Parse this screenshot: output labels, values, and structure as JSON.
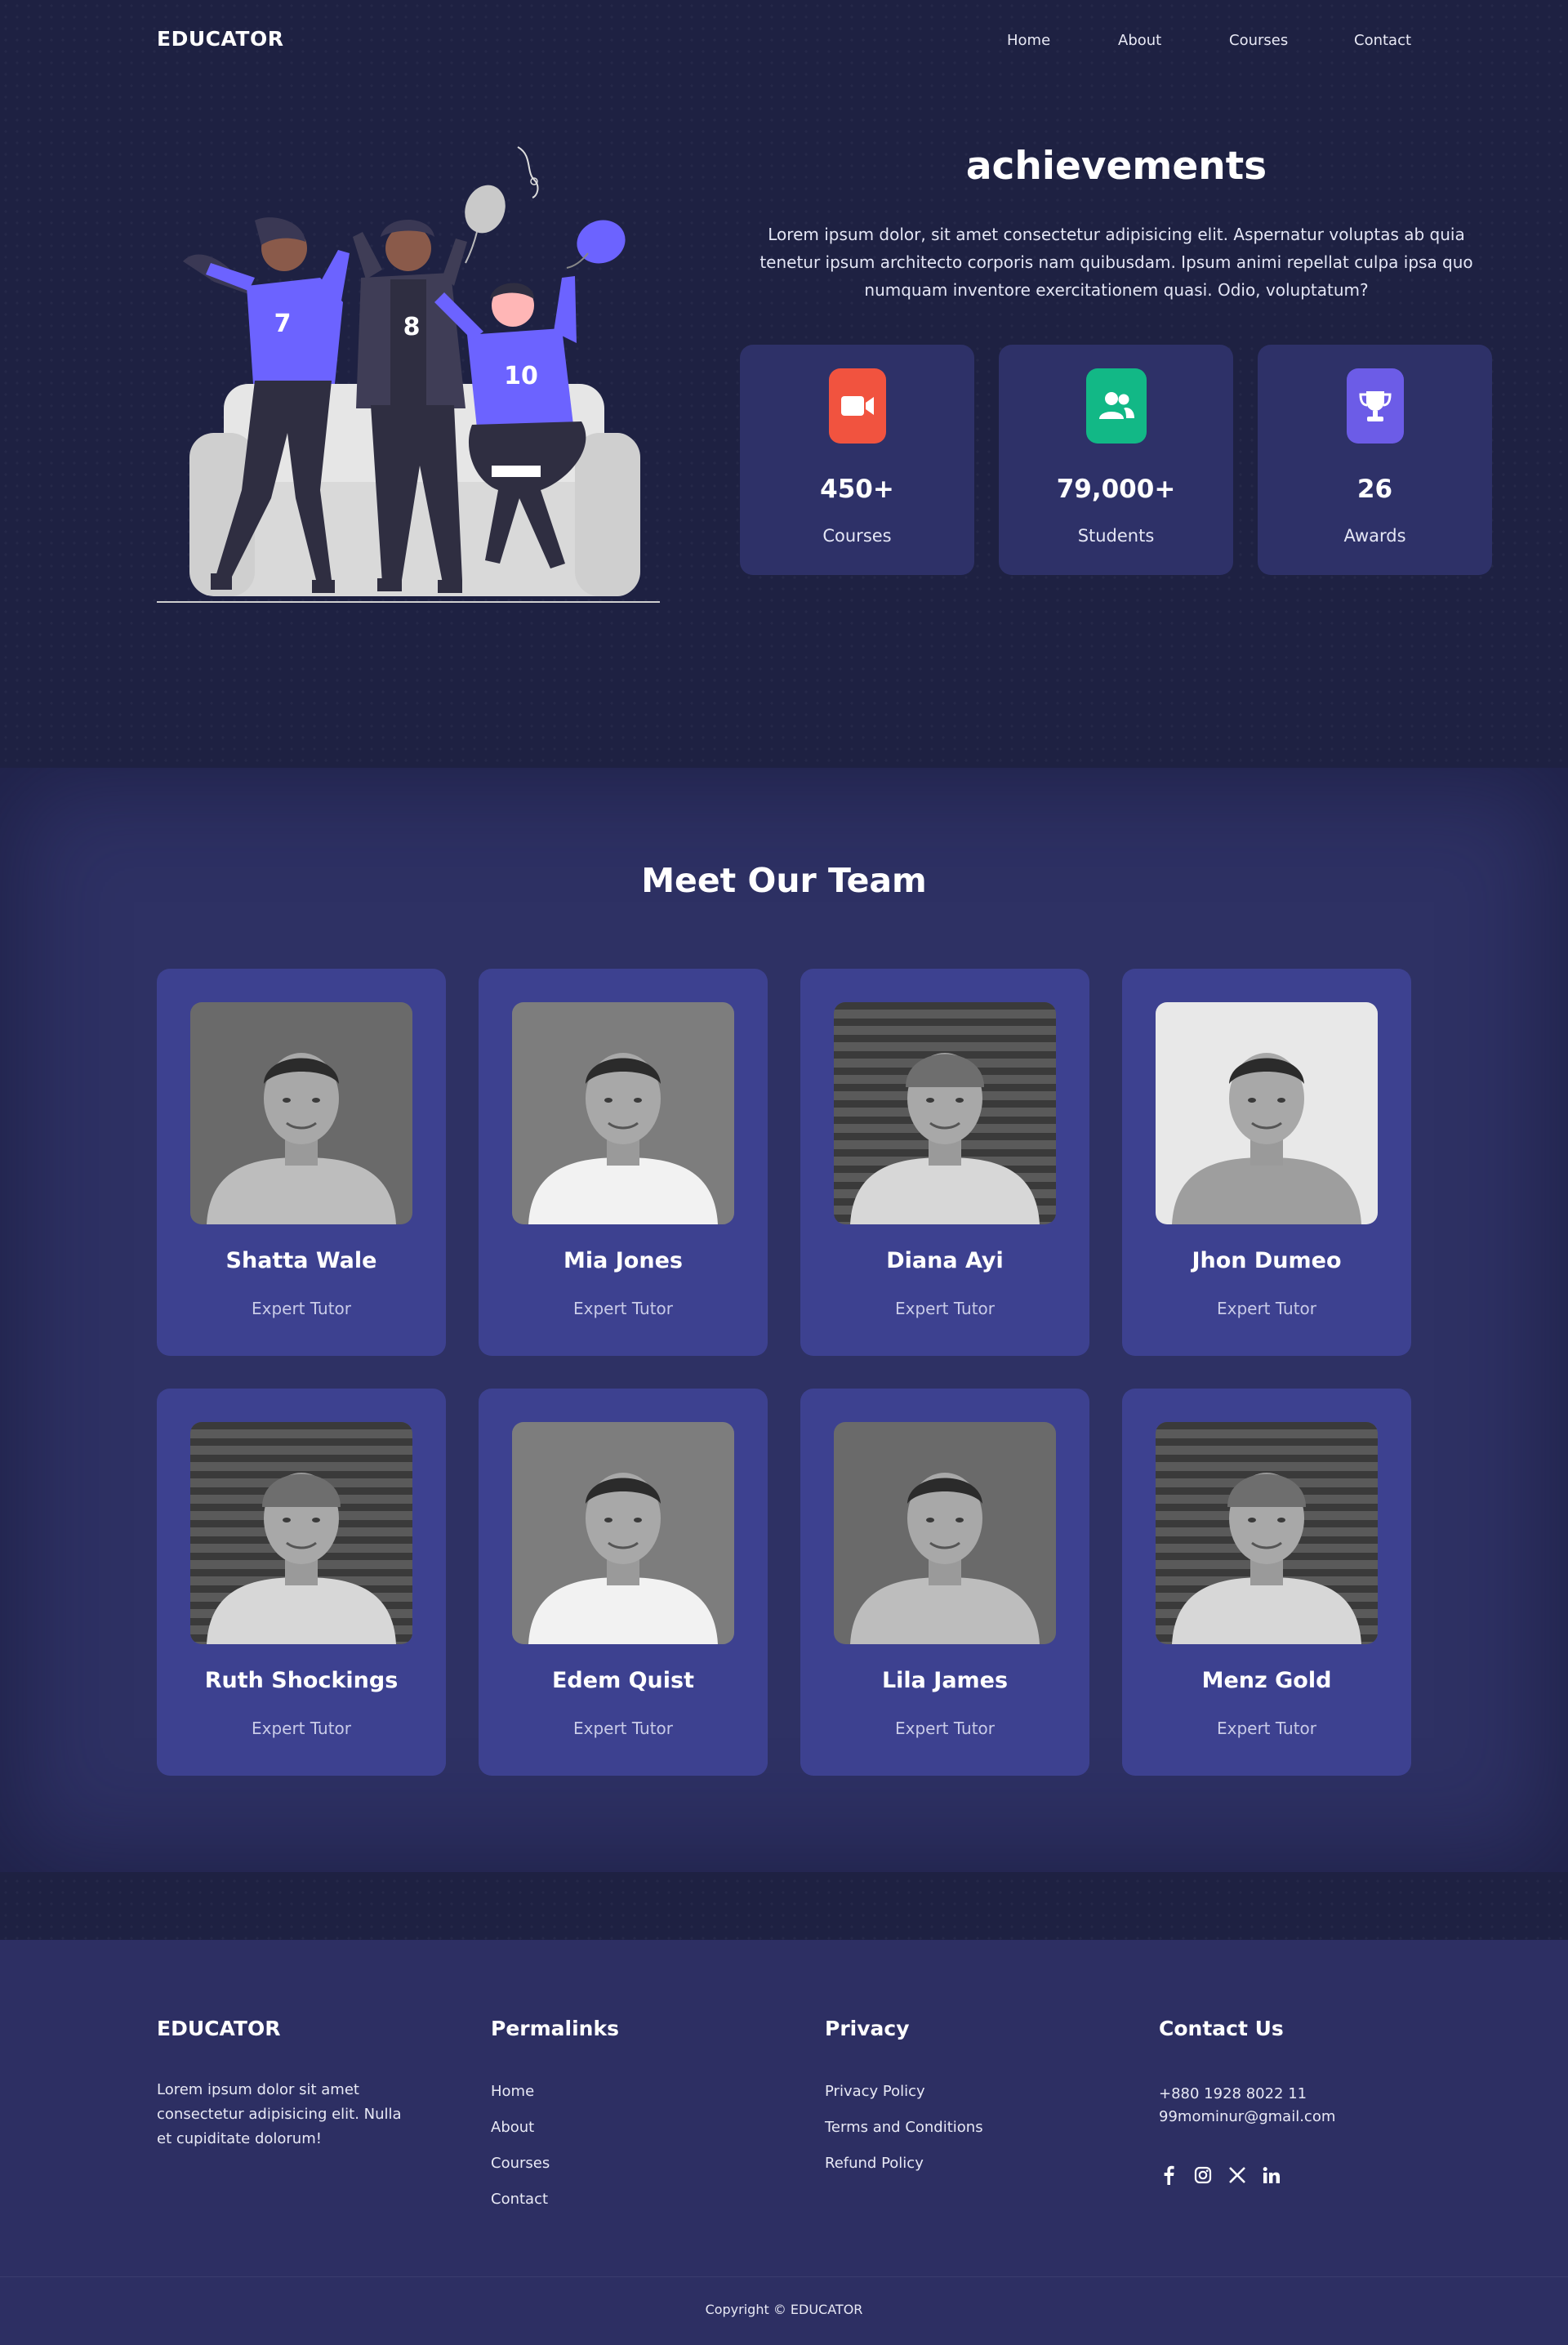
{
  "header": {
    "logo": "EDUCATOR",
    "nav": [
      "Home",
      "About",
      "Courses",
      "Contact"
    ]
  },
  "achievements": {
    "title": "achievements",
    "description": "Lorem ipsum dolor, sit amet consectetur adipisicing elit. Aspernatur voluptas ab quia tenetur ipsum architecto corporis nam quibusdam. Ipsum animi repellat culpa ipsa quo numquam inventore exercitationem quasi. Odio, voluptatum?",
    "stats": [
      {
        "value": "450+",
        "label": "Courses",
        "icon": "video-camera-icon",
        "color": "#f1533f"
      },
      {
        "value": "79,000+",
        "label": "Students",
        "icon": "users-icon",
        "color": "#12b886"
      },
      {
        "value": "26",
        "label": "Awards",
        "icon": "trophy-icon",
        "color": "#6c5ce7"
      }
    ],
    "illustration_jerseys": [
      "7",
      "8",
      "10"
    ]
  },
  "team": {
    "title": "Meet Our Team",
    "members": [
      {
        "name": "Shatta Wale",
        "role": "Expert Tutor"
      },
      {
        "name": "Mia Jones",
        "role": "Expert Tutor"
      },
      {
        "name": "Diana Ayi",
        "role": "Expert Tutor"
      },
      {
        "name": "Jhon Dumeo",
        "role": "Expert Tutor"
      },
      {
        "name": "Ruth Shockings",
        "role": "Expert Tutor"
      },
      {
        "name": "Edem Quist",
        "role": "Expert Tutor"
      },
      {
        "name": "Lila James",
        "role": "Expert Tutor"
      },
      {
        "name": "Menz Gold",
        "role": "Expert Tutor"
      }
    ]
  },
  "footer": {
    "brand": {
      "title": "EDUCATOR",
      "text": "Lorem ipsum dolor sit amet consectetur adipisicing elit. Nulla et cupiditate dolorum!"
    },
    "permalinks": {
      "title": "Permalinks",
      "links": [
        "Home",
        "About",
        "Courses",
        "Contact"
      ]
    },
    "privacy": {
      "title": "Privacy",
      "links": [
        "Privacy Policy",
        "Terms and Conditions",
        "Refund Policy"
      ]
    },
    "contact": {
      "title": "Contact Us",
      "phone": "+880 1928 8022 11",
      "email": "99mominur@gmail.com",
      "socials": [
        "facebook-icon",
        "instagram-icon",
        "x-icon",
        "linkedin-icon"
      ]
    },
    "copyright": "Copyright © EDUCATOR"
  },
  "colors": {
    "page_bg": "#1e2142",
    "card_bg": "#2e3168",
    "team_card_bg": "#3d4190",
    "accent_purple": "#6c63ff"
  }
}
